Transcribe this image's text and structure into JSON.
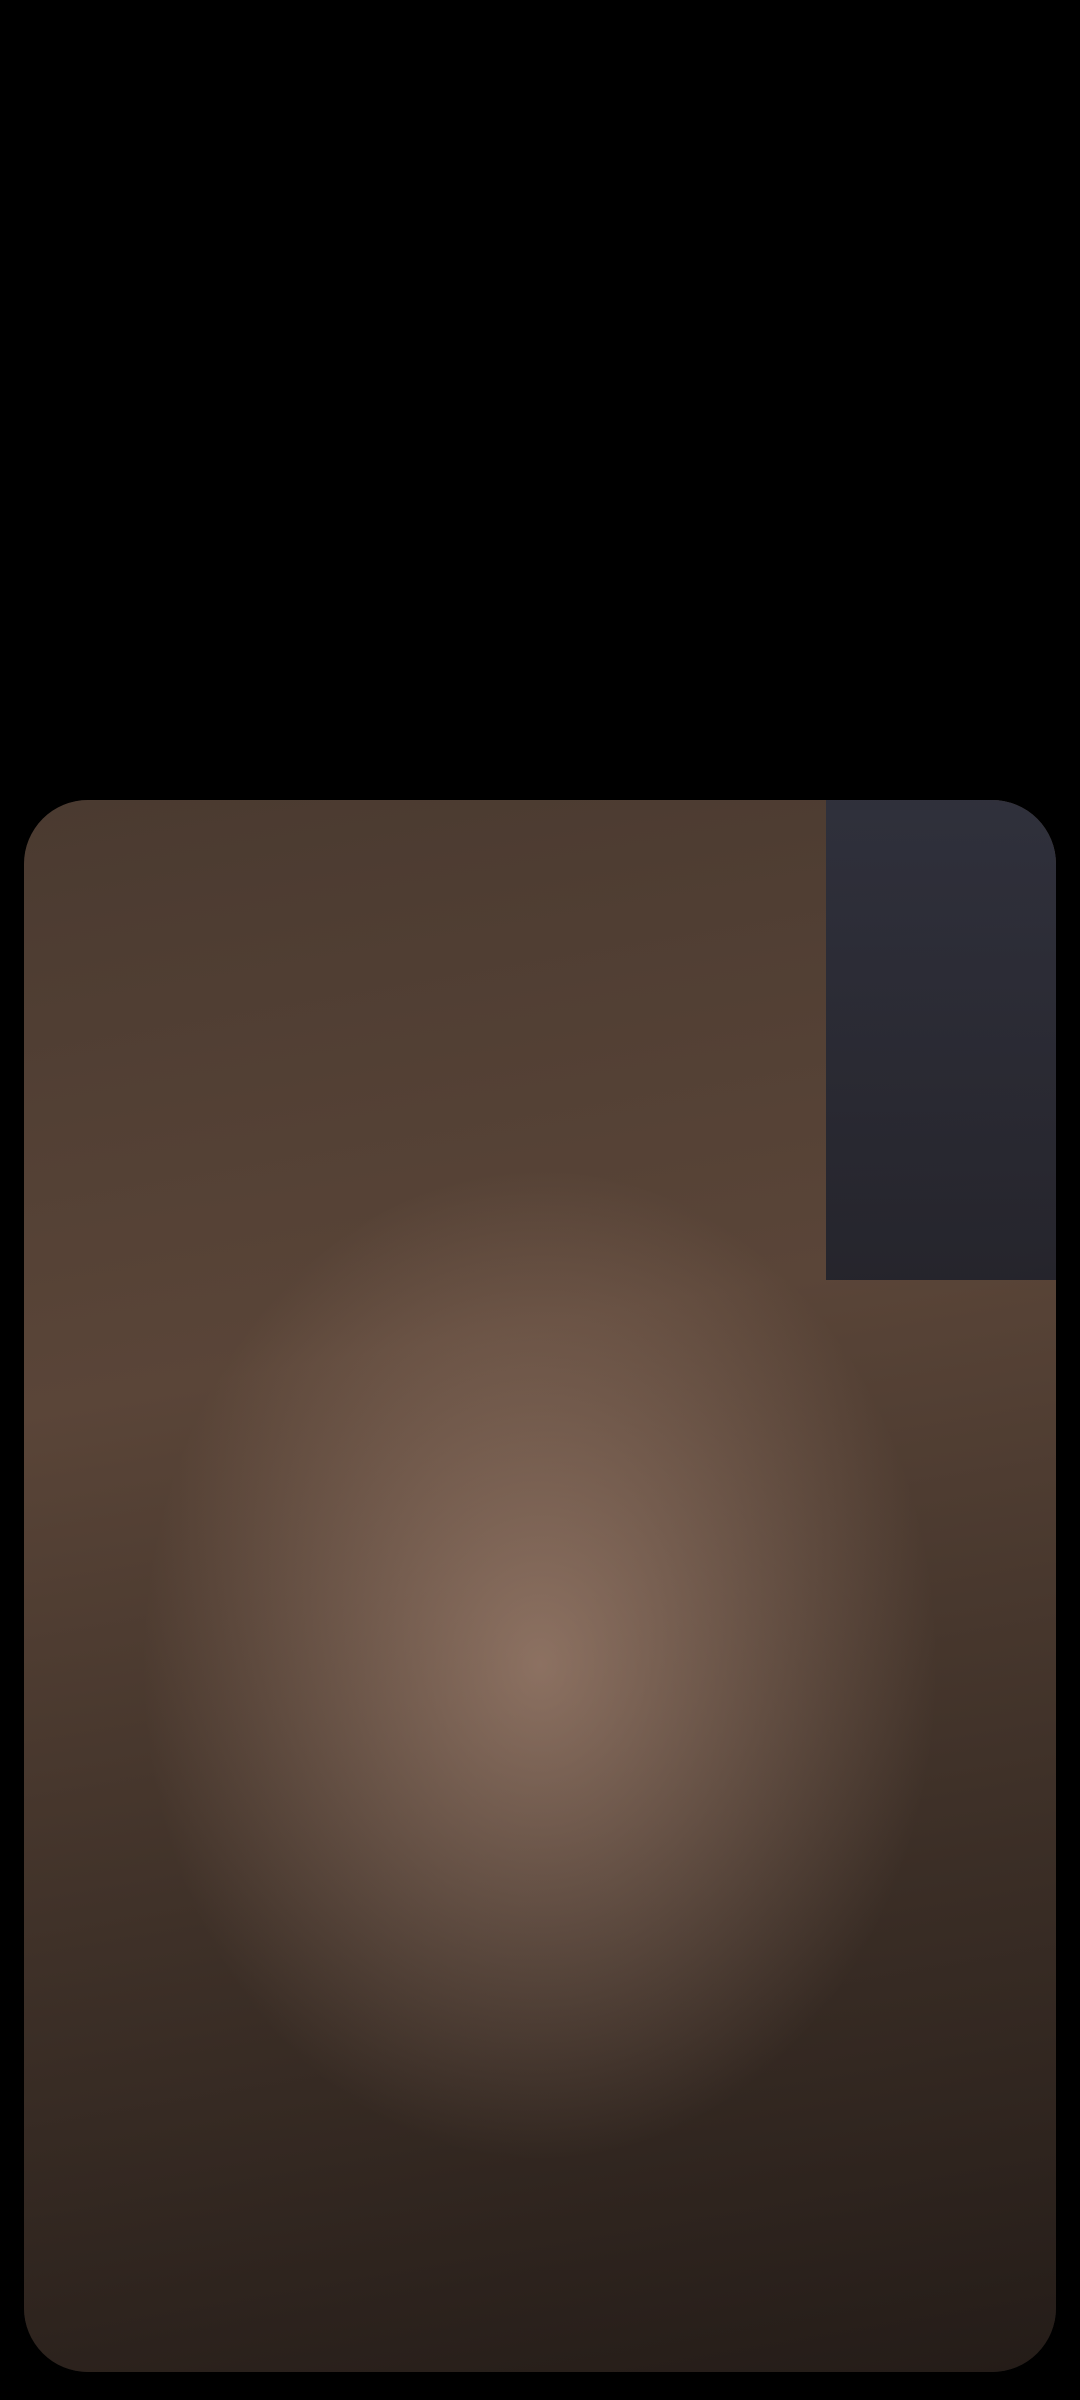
{
  "viewer": {
    "background_color": "#000000",
    "photo": {
      "kind": "selfie photo",
      "note_visible_text": ""
    }
  }
}
